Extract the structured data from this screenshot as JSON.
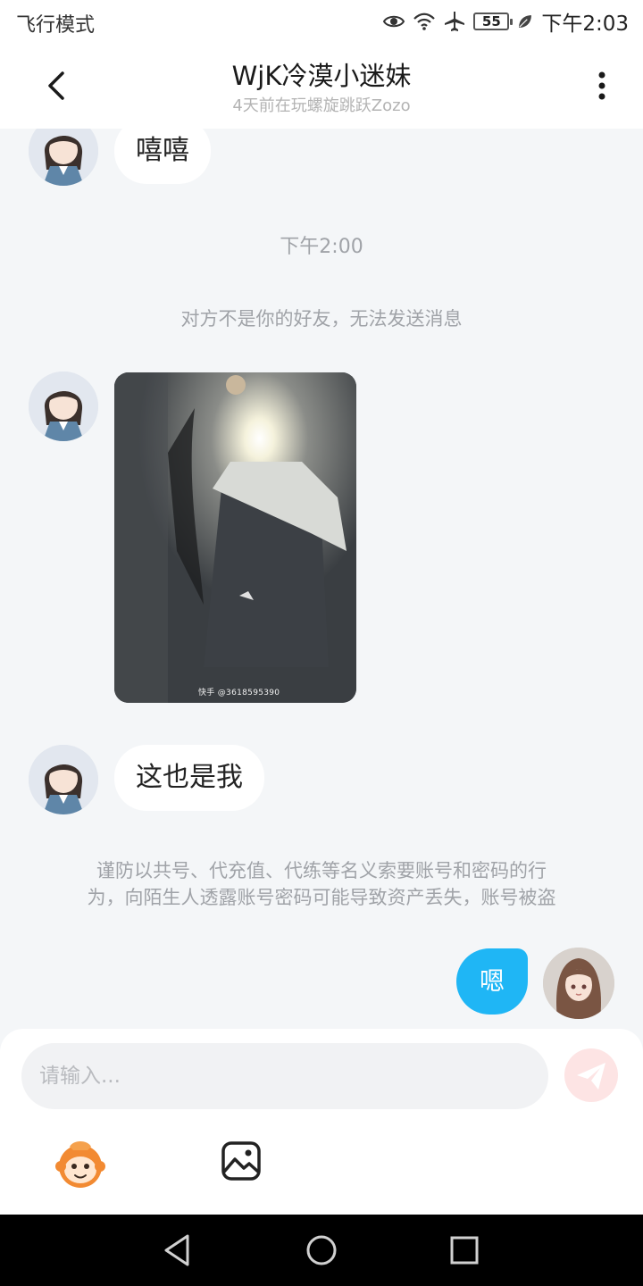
{
  "status_bar": {
    "mode": "飞行模式",
    "battery": "55",
    "time": "下午2:03",
    "icons": [
      "eye-icon",
      "wifi-icon",
      "airplane-icon",
      "battery-icon",
      "leaf-icon"
    ]
  },
  "header": {
    "title": "WjK冷漠小迷妹",
    "subtitle": "4天前在玩螺旋跳跃Zozo",
    "back_icon": "chevron-left-icon",
    "more_icon": "more-vertical-icon"
  },
  "chat": {
    "message_1": "嘻嘻",
    "time_divider": "下午2:00",
    "notice_not_friend": "对方不是你的好友，无法发送消息",
    "photo_watermark": "快手 @3618595390",
    "message_2": "这也是我",
    "warning_line1": "谨防以共号、代充值、代练等名义索要账号和密码的行",
    "warning_line2": "为，向陌生人透露账号密码可能导致资产丢失，账号被盗",
    "my_message": "嗯"
  },
  "input": {
    "placeholder": "请输入...",
    "send_icon": "paper-plane-icon",
    "emoji_icon": "monkey-emoji-icon",
    "image_icon": "image-icon"
  },
  "colors": {
    "accent": "#1fb6f5",
    "background": "#f4f6f8",
    "send_disabled": "#fde4e4"
  }
}
